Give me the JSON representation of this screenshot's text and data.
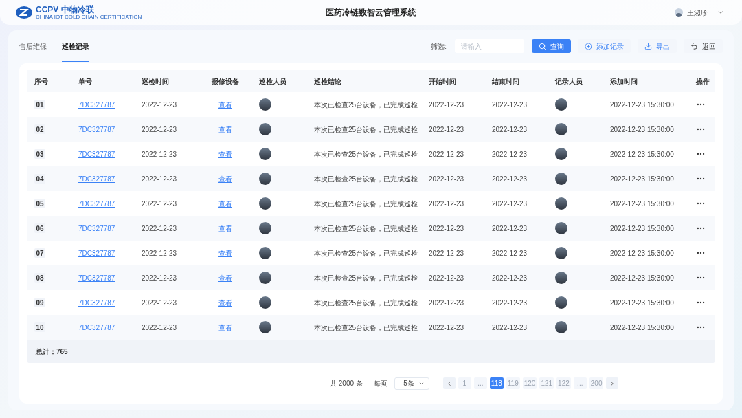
{
  "header": {
    "logo_text": "CCPV 中物冷联",
    "logo_subtitle": "CHINA IOT COLD CHAIN CERTIFICATION",
    "title": "医药冷链数智云管理系统",
    "user": "王淑珍"
  },
  "tabs": [
    {
      "label": "售后维保",
      "selected": false
    },
    {
      "label": "巡检记录",
      "selected": true
    }
  ],
  "toolbar": {
    "filter_label": "筛选:",
    "search": {
      "placeholder": "请输入"
    },
    "buttons": [
      {
        "kind": "primary",
        "label": "查询"
      },
      {
        "kind": "add",
        "label": "添加记录"
      },
      {
        "kind": "export",
        "label": "导出"
      },
      {
        "kind": "back",
        "label": "返回"
      }
    ]
  },
  "table": {
    "columns": [
      "序号",
      "单号",
      "巡检时间",
      "报修设备",
      "巡检人员",
      "巡检结论",
      "开始时间",
      "结束时间",
      "记录人员",
      "添加时间",
      "操作"
    ],
    "rows": [
      {
        "index": "01",
        "number": "7DC327787",
        "inspect_time": "2022-12-23",
        "device": "查看",
        "conclusion": "本次已检查25台设备，已完成巡检",
        "start": "2022-12-23",
        "end": "2022-12-23",
        "added": "2022-12-23 15:30:00"
      },
      {
        "index": "02",
        "number": "7DC327787",
        "inspect_time": "2022-12-23",
        "device": "查看",
        "conclusion": "本次已检查25台设备，已完成巡检",
        "start": "2022-12-23",
        "end": "2022-12-23",
        "added": "2022-12-23 15:30:00"
      },
      {
        "index": "03",
        "number": "7DC327787",
        "inspect_time": "2022-12-23",
        "device": "查看",
        "conclusion": "本次已检查25台设备，已完成巡检",
        "start": "2022-12-23",
        "end": "2022-12-23",
        "added": "2022-12-23 15:30:00"
      },
      {
        "index": "04",
        "number": "7DC327787",
        "inspect_time": "2022-12-23",
        "device": "查看",
        "conclusion": "本次已检查25台设备，已完成巡检",
        "start": "2022-12-23",
        "end": "2022-12-23",
        "added": "2022-12-23 15:30:00"
      },
      {
        "index": "05",
        "number": "7DC327787",
        "inspect_time": "2022-12-23",
        "device": "查看",
        "conclusion": "本次已检查25台设备，已完成巡检",
        "start": "2022-12-23",
        "end": "2022-12-23",
        "added": "2022-12-23 15:30:00"
      },
      {
        "index": "06",
        "number": "7DC327787",
        "inspect_time": "2022-12-23",
        "device": "查看",
        "conclusion": "本次已检查25台设备，已完成巡检",
        "start": "2022-12-23",
        "end": "2022-12-23",
        "added": "2022-12-23 15:30:00"
      },
      {
        "index": "07",
        "number": "7DC327787",
        "inspect_time": "2022-12-23",
        "device": "查看",
        "conclusion": "本次已检查25台设备，已完成巡检",
        "start": "2022-12-23",
        "end": "2022-12-23",
        "added": "2022-12-23 15:30:00"
      },
      {
        "index": "08",
        "number": "7DC327787",
        "inspect_time": "2022-12-23",
        "device": "查看",
        "conclusion": "本次已检查25台设备，已完成巡检",
        "start": "2022-12-23",
        "end": "2022-12-23",
        "added": "2022-12-23 15:30:00"
      },
      {
        "index": "09",
        "number": "7DC327787",
        "inspect_time": "2022-12-23",
        "device": "查看",
        "conclusion": "本次已检查25台设备，已完成巡检",
        "start": "2022-12-23",
        "end": "2022-12-23",
        "added": "2022-12-23 15:30:00"
      },
      {
        "index": "10",
        "number": "7DC327787",
        "inspect_time": "2022-12-23",
        "device": "查看",
        "conclusion": "本次已检查25台设备，已完成巡检",
        "start": "2022-12-23",
        "end": "2022-12-23",
        "added": "2022-12-23 15:30:00"
      }
    ],
    "total": "总计：765"
  },
  "pagination": {
    "total": "共 2000 条",
    "per_page_label": "每页",
    "per_page": "5条",
    "pages": [
      {
        "label": "1",
        "selected": false
      },
      {
        "label": "...",
        "selected": false
      },
      {
        "label": "118",
        "selected": true
      },
      {
        "label": "119",
        "selected": false
      },
      {
        "label": "120",
        "selected": false
      },
      {
        "label": "121",
        "selected": false
      },
      {
        "label": "122",
        "selected": false
      },
      {
        "label": "...",
        "selected": false
      },
      {
        "label": "200",
        "selected": false
      }
    ]
  }
}
